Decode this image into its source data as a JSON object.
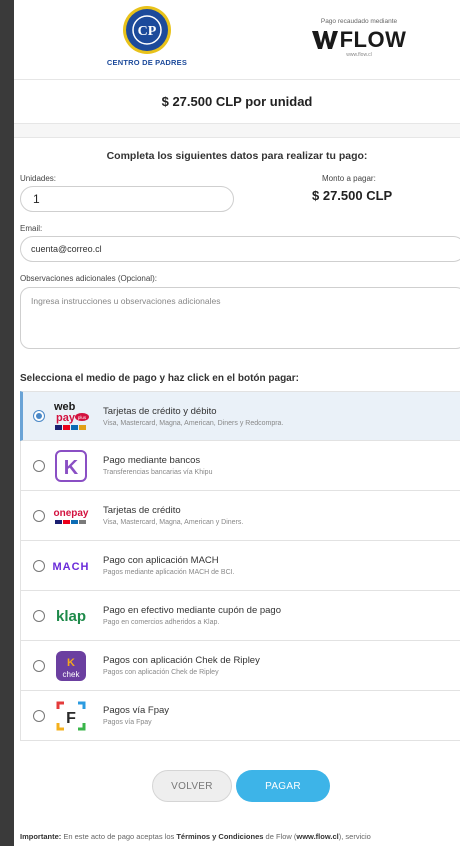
{
  "header": {
    "org_initials": "CP",
    "org_name": "CENTRO DE PADRES",
    "flow_caption": "Pago recaudado mediante",
    "flow_name": "FLOW",
    "flow_url": "www.flow.cl"
  },
  "price": "$ 27.500 CLP por unidad",
  "form": {
    "instruction": "Completa los siguientes datos para realizar tu pago:",
    "units_label": "Unidades:",
    "units_value": "1",
    "amount_label": "Monto a pagar:",
    "amount_value": "$ 27.500 CLP",
    "email_label": "Email:",
    "email_value": "cuenta@correo.cl",
    "obs_label": "Observaciones adicionales (Opcional):",
    "obs_placeholder": "Ingresa instrucciones u observaciones adicionales"
  },
  "payment": {
    "title": "Selecciona el medio de pago y haz click en el botón pagar:",
    "methods": [
      {
        "logo": "webpay-icon",
        "title": "Tarjetas de crédito y débito",
        "subtitle": "Visa, Mastercard, Magna, American, Diners y Redcompra.",
        "selected": true
      },
      {
        "logo": "khipu-icon",
        "title": "Pago mediante bancos",
        "subtitle": "Transferencias bancarias vía Khipu",
        "selected": false
      },
      {
        "logo": "onepay-icon",
        "title": "Tarjetas de crédito",
        "subtitle": "Visa, Mastercard, Magna, American y Diners.",
        "selected": false
      },
      {
        "logo": "mach-icon",
        "title": "Pago con aplicación MACH",
        "subtitle": "Pagos mediante aplicación MACH de BCI.",
        "selected": false
      },
      {
        "logo": "klap-icon",
        "title": "Pago en efectivo mediante cupón de pago",
        "subtitle": "Pago en comercios adheridos a Klap.",
        "selected": false
      },
      {
        "logo": "chek-icon",
        "title": "Pagos con aplicación Chek de Ripley",
        "subtitle": "Pagos con aplicación Chek de Ripley",
        "selected": false
      },
      {
        "logo": "fpay-icon",
        "title": "Pagos vía Fpay",
        "subtitle": "Pagos vía Fpay",
        "selected": false
      }
    ],
    "logo_text": {
      "webpay_top": "web",
      "webpay_bottom": "pay",
      "webpay_plus": "plus",
      "onepay": "onepay",
      "mach": "MACH",
      "klap": "klap",
      "chek": "chek",
      "khipu": "K",
      "fpay": "F"
    }
  },
  "buttons": {
    "back": "VOLVER",
    "pay": "PAGAR"
  },
  "footer": {
    "important": "Importante:",
    "text1": " En este acto de pago aceptas los ",
    "terms": "Términos y Condiciones",
    "text2": " de Flow (",
    "url": "www.flow.cl",
    "text3": "), servicio"
  },
  "colors": {
    "accent": "#3db4e8",
    "brand_blue": "#1c4a9b",
    "selected_bg": "#eaf1f8"
  }
}
